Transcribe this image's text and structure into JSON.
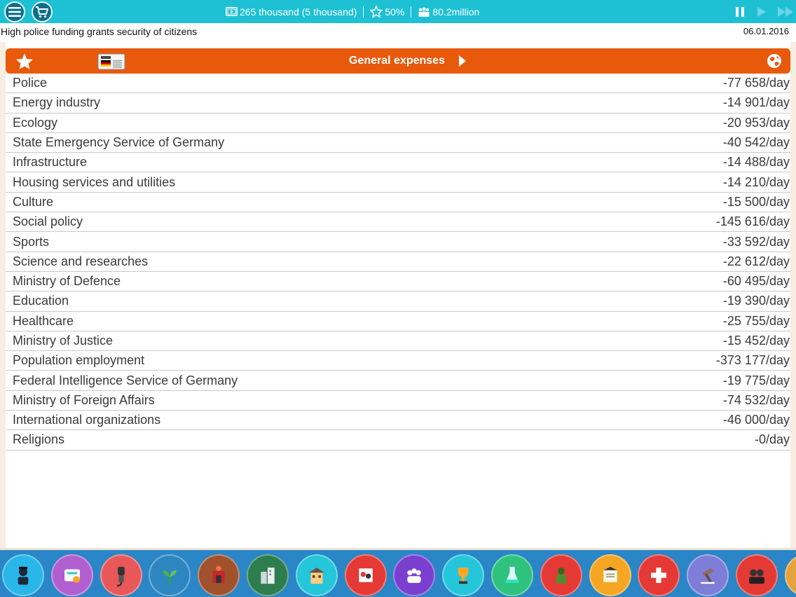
{
  "topbar": {
    "menu_icon": "menu-icon",
    "shop_icon": "shopping-cart-icon",
    "money": "265 thousand (5 thousand)",
    "rating": "50%",
    "population": "80.2million",
    "colors": {
      "bar": "#1ec0d4",
      "button": "#0c6f8a"
    }
  },
  "news": {
    "text": "High police funding grants security of citizens",
    "date": "06.01.2016"
  },
  "panel": {
    "title": "General expenses",
    "header_color": "#e8590c"
  },
  "expenses": [
    {
      "name": "Police",
      "value": "-77 658/day"
    },
    {
      "name": "Energy industry",
      "value": "-14 901/day"
    },
    {
      "name": "Ecology",
      "value": "-20 953/day"
    },
    {
      "name": "State Emergency Service of Germany",
      "value": "-40 542/day"
    },
    {
      "name": "Infrastructure",
      "value": "-14 488/day"
    },
    {
      "name": "Housing services and utilities",
      "value": "-14 210/day"
    },
    {
      "name": "Culture",
      "value": "-15 500/day"
    },
    {
      "name": "Social policy",
      "value": "-145 616/day"
    },
    {
      "name": "Sports",
      "value": "-33 592/day"
    },
    {
      "name": "Science and researches",
      "value": "-22 612/day"
    },
    {
      "name": "Ministry of Defence",
      "value": "-60 495/day"
    },
    {
      "name": "Education",
      "value": "-19 390/day"
    },
    {
      "name": "Healthcare",
      "value": "-25 755/day"
    },
    {
      "name": "Ministry of Justice",
      "value": "-15 452/day"
    },
    {
      "name": "Population employment",
      "value": "-373 177/day"
    },
    {
      "name": "Federal Intelligence Service of Germany",
      "value": "-19 775/day"
    },
    {
      "name": "Ministry of Foreign Affairs",
      "value": "-74 532/day"
    },
    {
      "name": "International organizations",
      "value": "-46 000/day"
    },
    {
      "name": "Religions",
      "value": "-0/day"
    }
  ],
  "dock": [
    {
      "icon": "police-icon",
      "color": "#29b6e8"
    },
    {
      "icon": "economy-icon",
      "color": "#b15fd0"
    },
    {
      "icon": "energy-icon",
      "color": "#e85858"
    },
    {
      "icon": "ecology-icon",
      "color": "#2e86c1"
    },
    {
      "icon": "emergency-icon",
      "color": "#a0522d"
    },
    {
      "icon": "infrastructure-icon",
      "color": "#2e7d4f"
    },
    {
      "icon": "housing-icon",
      "color": "#26c6da"
    },
    {
      "icon": "culture-icon",
      "color": "#e53935"
    },
    {
      "icon": "social-policy-icon",
      "color": "#7b3fd0"
    },
    {
      "icon": "sports-icon",
      "color": "#26c6da"
    },
    {
      "icon": "science-icon",
      "color": "#2ec27e"
    },
    {
      "icon": "defence-icon",
      "color": "#e53935"
    },
    {
      "icon": "education-icon",
      "color": "#f5a623"
    },
    {
      "icon": "healthcare-icon",
      "color": "#e53935"
    },
    {
      "icon": "justice-icon",
      "color": "#7e7ed8"
    },
    {
      "icon": "intelligence-icon",
      "color": "#e53935"
    },
    {
      "icon": "more-icon",
      "color": "#e6a23c"
    }
  ]
}
